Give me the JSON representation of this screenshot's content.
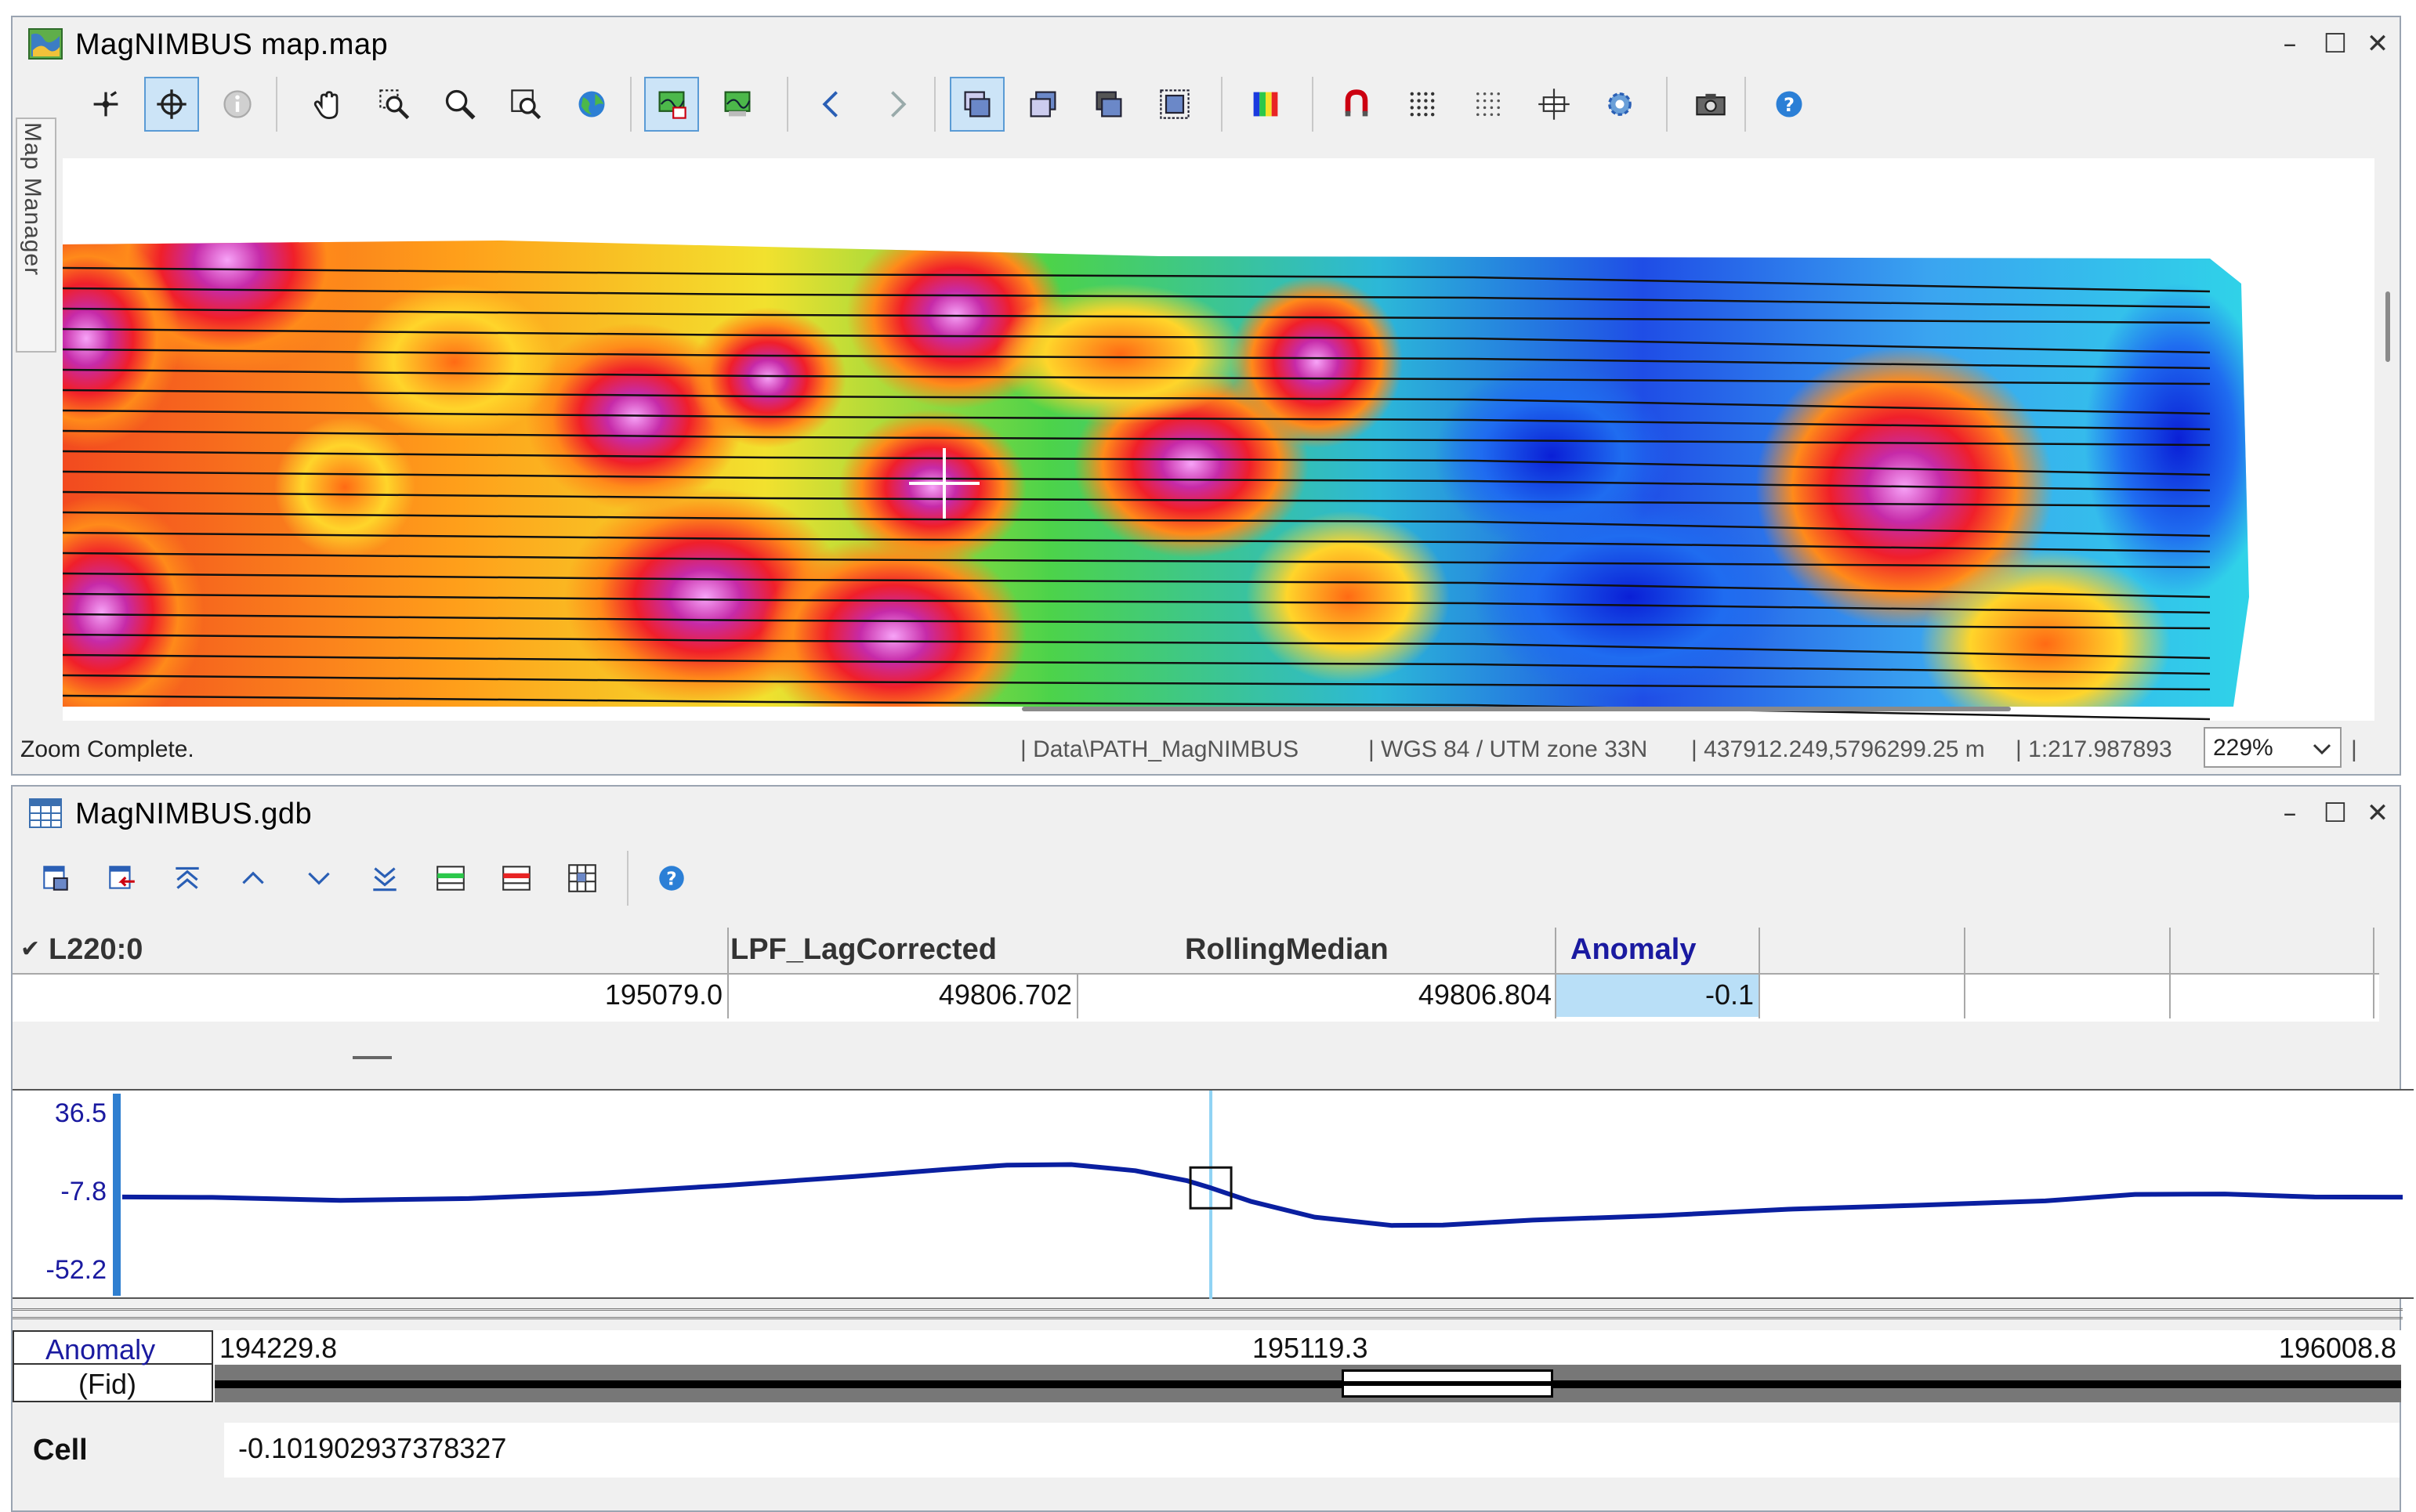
{
  "map_window": {
    "title": "MagNIMBUS map.map",
    "side_tab": "Map Manager",
    "toolbar": [
      {
        "icon": "digitize-icon",
        "tooltip": ""
      },
      {
        "icon": "select-point-icon",
        "active": true
      },
      {
        "icon": "info-icon"
      },
      {
        "icon": "pan-hand-icon"
      },
      {
        "icon": "zoom-area-icon"
      },
      {
        "icon": "zoom-icon"
      },
      {
        "icon": "zoom-extent-icon"
      },
      {
        "icon": "globe-icon"
      },
      {
        "icon": "map-layer-icon",
        "active": true
      },
      {
        "icon": "map-layer-alt-icon"
      },
      {
        "icon": "back-arrow-icon"
      },
      {
        "icon": "forward-arrow-icon"
      },
      {
        "icon": "view-1-icon",
        "active": true
      },
      {
        "icon": "view-2-icon"
      },
      {
        "icon": "view-3-icon"
      },
      {
        "icon": "view-4-icon"
      },
      {
        "icon": "colour-bar-icon"
      },
      {
        "icon": "magnet-icon"
      },
      {
        "icon": "dots-grid-icon"
      },
      {
        "icon": "dots-grid-2-icon"
      },
      {
        "icon": "move-icon"
      },
      {
        "icon": "settings-gear-icon"
      },
      {
        "icon": "camera-icon"
      },
      {
        "icon": "help-icon"
      }
    ],
    "status": {
      "message": "Zoom Complete.",
      "path": "| Data\\PATH_MagNIMBUS",
      "projection": "| WGS 84 / UTM zone 33N",
      "coordinates": "| 437912.249,5796299.25 m",
      "scale": "| 1:217.987893",
      "zoom": "229%",
      "trailing": "|"
    }
  },
  "gdb_window": {
    "title": "MagNIMBUS.gdb",
    "toolbar": [
      {
        "icon": "database-new-icon"
      },
      {
        "icon": "database-import-icon"
      },
      {
        "icon": "first-line-icon"
      },
      {
        "icon": "previous-line-icon"
      },
      {
        "icon": "next-line-icon"
      },
      {
        "icon": "last-line-icon"
      },
      {
        "icon": "channel-list-icon"
      },
      {
        "icon": "channel-red-icon"
      },
      {
        "icon": "grid-view-icon"
      },
      {
        "icon": "help-icon"
      }
    ],
    "grid": {
      "line_label": "L220:0",
      "check": "✔",
      "columns": [
        "LPF_LagCorrected",
        "RollingMedian",
        "Anomaly"
      ],
      "row": {
        "fid": "195079.0",
        "LPF_LagCorrected": "49806.702",
        "RollingMedian": "49806.804",
        "Anomaly": "-0.1"
      }
    },
    "profile": {
      "y_ticks": [
        "36.5",
        "-7.8",
        "-52.2"
      ],
      "channel": "Anomaly",
      "fid_label": "(Fid)",
      "x_ticks": [
        "194229.8",
        "195119.3",
        "196008.8"
      ],
      "y_min": -52.2,
      "y_max": 36.5,
      "x_min": 194229.8,
      "x_max": 196008.8,
      "cursor_x": 195079.0,
      "points": [
        [
          194229.8,
          -7.8
        ],
        [
          194300,
          -8.0
        ],
        [
          194400,
          -9.5
        ],
        [
          194500,
          -8.6
        ],
        [
          194600,
          -6.0
        ],
        [
          194700,
          -2.0
        ],
        [
          194800,
          2.5
        ],
        [
          194870,
          6.0
        ],
        [
          194920,
          8.3
        ],
        [
          194970,
          8.6
        ],
        [
          195020,
          5.5
        ],
        [
          195060,
          0.5
        ],
        [
          195079,
          -3.2
        ],
        [
          195110,
          -10.0
        ],
        [
          195160,
          -18.0
        ],
        [
          195220,
          -22.2
        ],
        [
          195260,
          -22.0
        ],
        [
          195330,
          -19.5
        ],
        [
          195430,
          -17.2
        ],
        [
          195530,
          -14.0
        ],
        [
          195630,
          -12.0
        ],
        [
          195730,
          -9.8
        ],
        [
          195800,
          -6.5
        ],
        [
          195870,
          -6.3
        ],
        [
          195940,
          -7.8
        ],
        [
          196008.8,
          -7.9
        ]
      ],
      "colors": {
        "trace": "#0a1fa0",
        "cursor": "#8fd3f4"
      }
    },
    "cell": {
      "label": "Cell",
      "value": "-0.101902937378327"
    }
  }
}
